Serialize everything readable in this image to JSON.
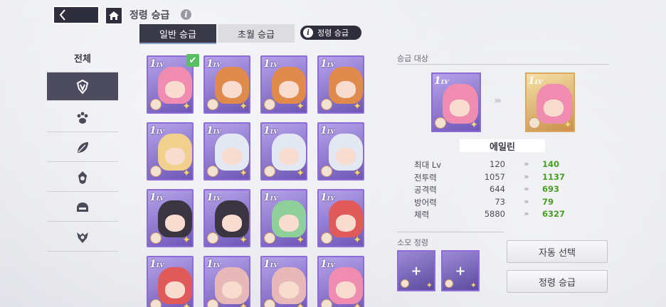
{
  "header": {
    "title": "정령 승급",
    "info_symbol": "i"
  },
  "tabs": {
    "normal": "일반 승급",
    "over": "초월 승급",
    "guide": "정령 승급"
  },
  "sidebar": {
    "all_label": "전체",
    "items": [
      {
        "icon": "crest-icon"
      },
      {
        "icon": "paw-icon"
      },
      {
        "icon": "leaf-icon"
      },
      {
        "icon": "flame-crest-icon"
      },
      {
        "icon": "helmet-icon"
      },
      {
        "icon": "demon-crest-icon"
      }
    ]
  },
  "grid": {
    "level_prefix": "1",
    "level_suffix": "LV",
    "selected_check": "✔",
    "cards": [
      {
        "hair": "#f08cb0",
        "selected": true
      },
      {
        "hair": "#e08a4c"
      },
      {
        "hair": "#e08a4c"
      },
      {
        "hair": "#e08a4c"
      },
      {
        "hair": "#f0d08c"
      },
      {
        "hair": "#e4e8f2"
      },
      {
        "hair": "#e4e8f2"
      },
      {
        "hair": "#e4e8f2"
      },
      {
        "hair": "#3a3540"
      },
      {
        "hair": "#3a3540"
      },
      {
        "hair": "#8fcf9a"
      },
      {
        "hair": "#e05a5a"
      },
      {
        "hair": "#e05a5a"
      },
      {
        "hair": "#e8b8b8"
      },
      {
        "hair": "#e8b8b8"
      },
      {
        "hair": "#f08cb0"
      }
    ]
  },
  "target": {
    "label": "승급 대상",
    "name": "에일린",
    "from_level": "1",
    "to_level": "1",
    "arrows": "›››"
  },
  "stats": [
    {
      "label": "최대 Lv",
      "from": "120",
      "to": "140"
    },
    {
      "label": "전투력",
      "from": "1057",
      "to": "1137"
    },
    {
      "label": "공격력",
      "from": "644",
      "to": "693"
    },
    {
      "label": "방어력",
      "from": "73",
      "to": "79"
    },
    {
      "label": "체력",
      "from": "5880",
      "to": "6327"
    }
  ],
  "material": {
    "label": "소모 정령",
    "slot_symbol": "+"
  },
  "buttons": {
    "auto_select": "자동 선택",
    "promote": "정령 승급"
  },
  "colors": {
    "accent_dark": "#2f2e3d",
    "card_purple": "#8d6cd6",
    "card_gold": "#d8a85c",
    "increase_green": "#45a020"
  }
}
